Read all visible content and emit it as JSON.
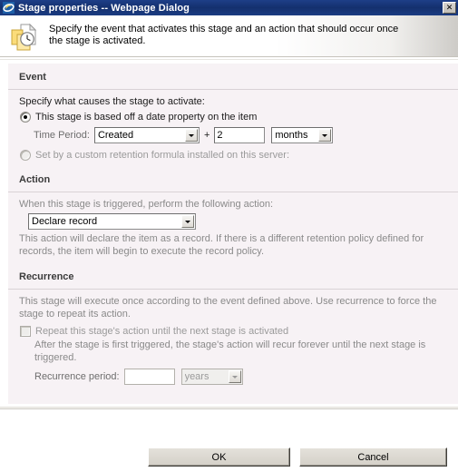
{
  "window": {
    "title": "Stage properties -- Webpage Dialog",
    "icon": "internet-explorer-icon",
    "close_label": "✕"
  },
  "header": {
    "icon": "documents-clock-icon",
    "description": "Specify the event that activates this stage and an action that should occur once the stage is activated."
  },
  "sections": {
    "event": {
      "title": "Event",
      "prompt": "Specify what causes the stage to activate:",
      "option_date_property": {
        "label": "This stage is based off a date property on the item",
        "selected": true,
        "enabled": true
      },
      "time_period": {
        "label": "Time Period:",
        "property_value": "Created",
        "plus": "+",
        "amount_value": "2",
        "unit_value": "months"
      },
      "option_custom_formula": {
        "label": "Set by a custom retention formula installed on this server:",
        "selected": false,
        "enabled": false
      }
    },
    "action": {
      "title": "Action",
      "prompt": "When this stage is triggered, perform the following action:",
      "action_value": "Declare record",
      "description": "This action will declare the item as a record. If there is a different retention policy defined for records, the item will begin to execute the record policy."
    },
    "recurrence": {
      "title": "Recurrence",
      "description": "This stage will execute once according to the event defined above. Use recurrence to force the stage to repeat its action.",
      "repeat_checkbox": {
        "label": "Repeat this stage's action until the next stage is activated",
        "checked": false,
        "enabled": false
      },
      "repeat_help": "After the stage is first triggered, the stage's action will recur forever until the next stage is triggered.",
      "recurrence_period": {
        "label": "Recurrence period:",
        "amount_value": "",
        "unit_value": "years"
      }
    }
  },
  "footer": {
    "ok_label": "OK",
    "cancel_label": "Cancel"
  },
  "colors": {
    "titlebar": "#14306e",
    "panel_bg": "#f7f2f5",
    "button_face": "#d4d0c8",
    "disabled_text": "#9a9a9a"
  }
}
